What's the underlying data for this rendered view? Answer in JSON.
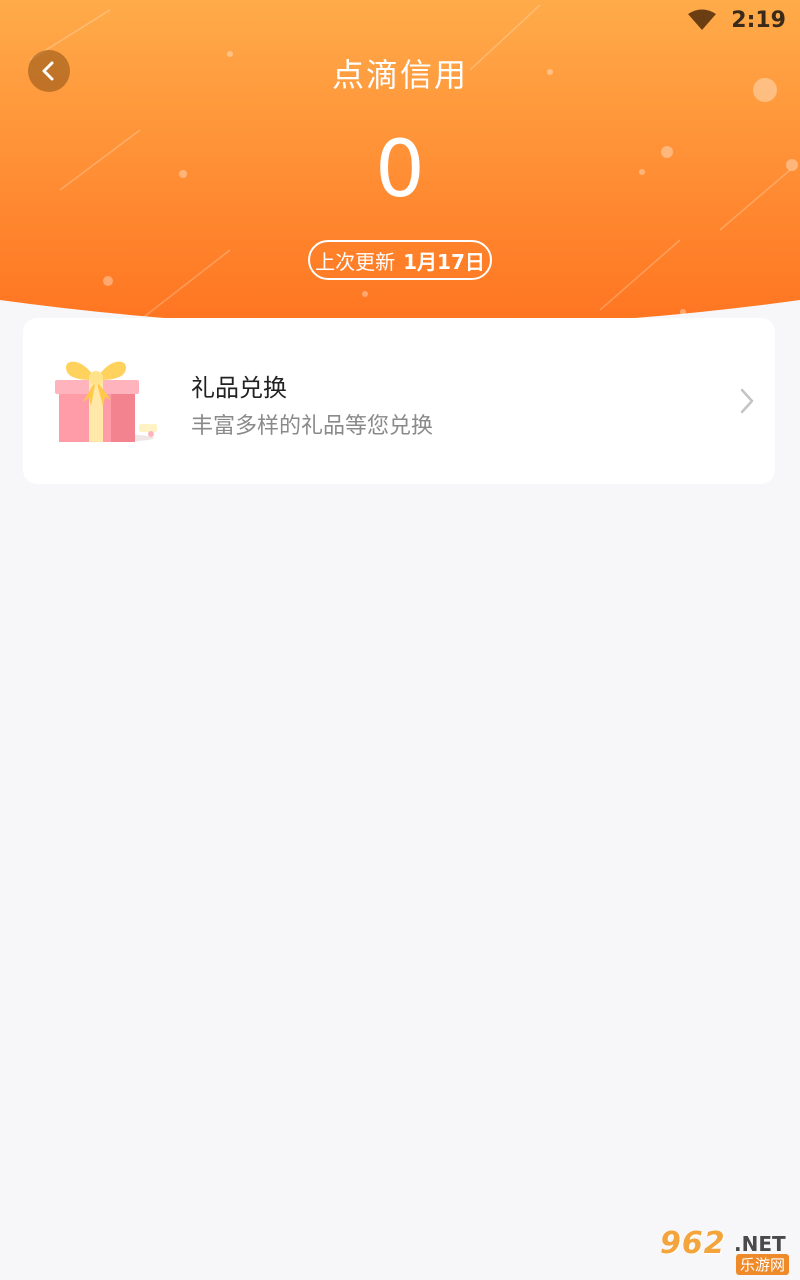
{
  "status_bar": {
    "time": "2:19",
    "wifi_icon": "wifi-icon"
  },
  "header": {
    "title": "点滴信用",
    "score": "0",
    "update_label": "上次更新",
    "update_date": "1月17日",
    "gradient_top": "#ffab4a",
    "gradient_bottom": "#ff7420"
  },
  "gift_card": {
    "title": "礼品兑换",
    "subtitle": "丰富多样的礼品等您兑换",
    "icon": "gift-box-icon",
    "chevron_icon": "chevron-right-icon"
  },
  "watermark": {
    "number": "962",
    "domain": ".NET",
    "site_name": "乐游网"
  }
}
